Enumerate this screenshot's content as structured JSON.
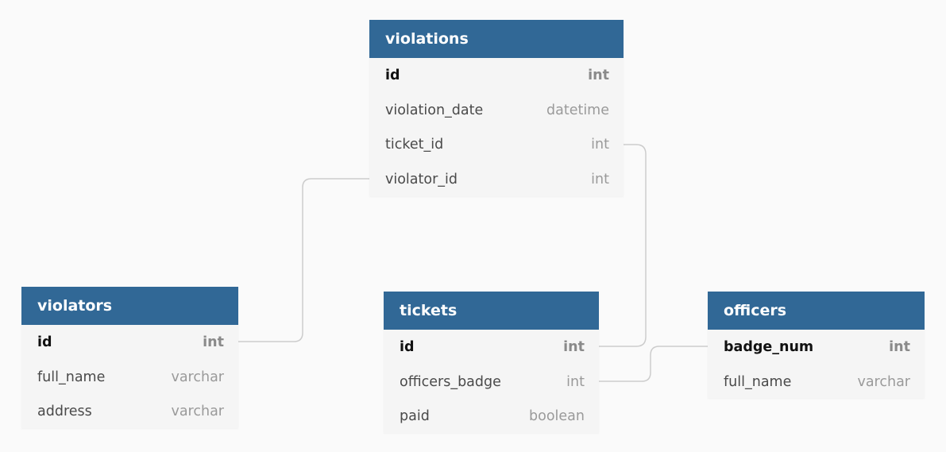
{
  "tables": {
    "violations": {
      "name": "violations",
      "columns": [
        {
          "name": "id",
          "type": "int"
        },
        {
          "name": "violation_date",
          "type": "datetime"
        },
        {
          "name": "ticket_id",
          "type": "int"
        },
        {
          "name": "violator_id",
          "type": "int"
        }
      ]
    },
    "violators": {
      "name": "violators",
      "columns": [
        {
          "name": "id",
          "type": "int"
        },
        {
          "name": "full_name",
          "type": "varchar"
        },
        {
          "name": "address",
          "type": "varchar"
        }
      ]
    },
    "tickets": {
      "name": "tickets",
      "columns": [
        {
          "name": "id",
          "type": "int"
        },
        {
          "name": "officers_badge",
          "type": "int"
        },
        {
          "name": "paid",
          "type": "boolean"
        }
      ]
    },
    "officers": {
      "name": "officers",
      "columns": [
        {
          "name": "badge_num",
          "type": "int"
        },
        {
          "name": "full_name",
          "type": "varchar"
        }
      ]
    }
  },
  "relationships": [
    {
      "from": "violations.violator_id",
      "to": "violators.id"
    },
    {
      "from": "violations.ticket_id",
      "to": "tickets.id"
    },
    {
      "from": "tickets.officers_badge",
      "to": "officers.badge_num"
    }
  ],
  "colors": {
    "header": "#316896",
    "row_bg": "#f5f5f5",
    "connector": "#cccccc",
    "background": "#fafafa"
  }
}
